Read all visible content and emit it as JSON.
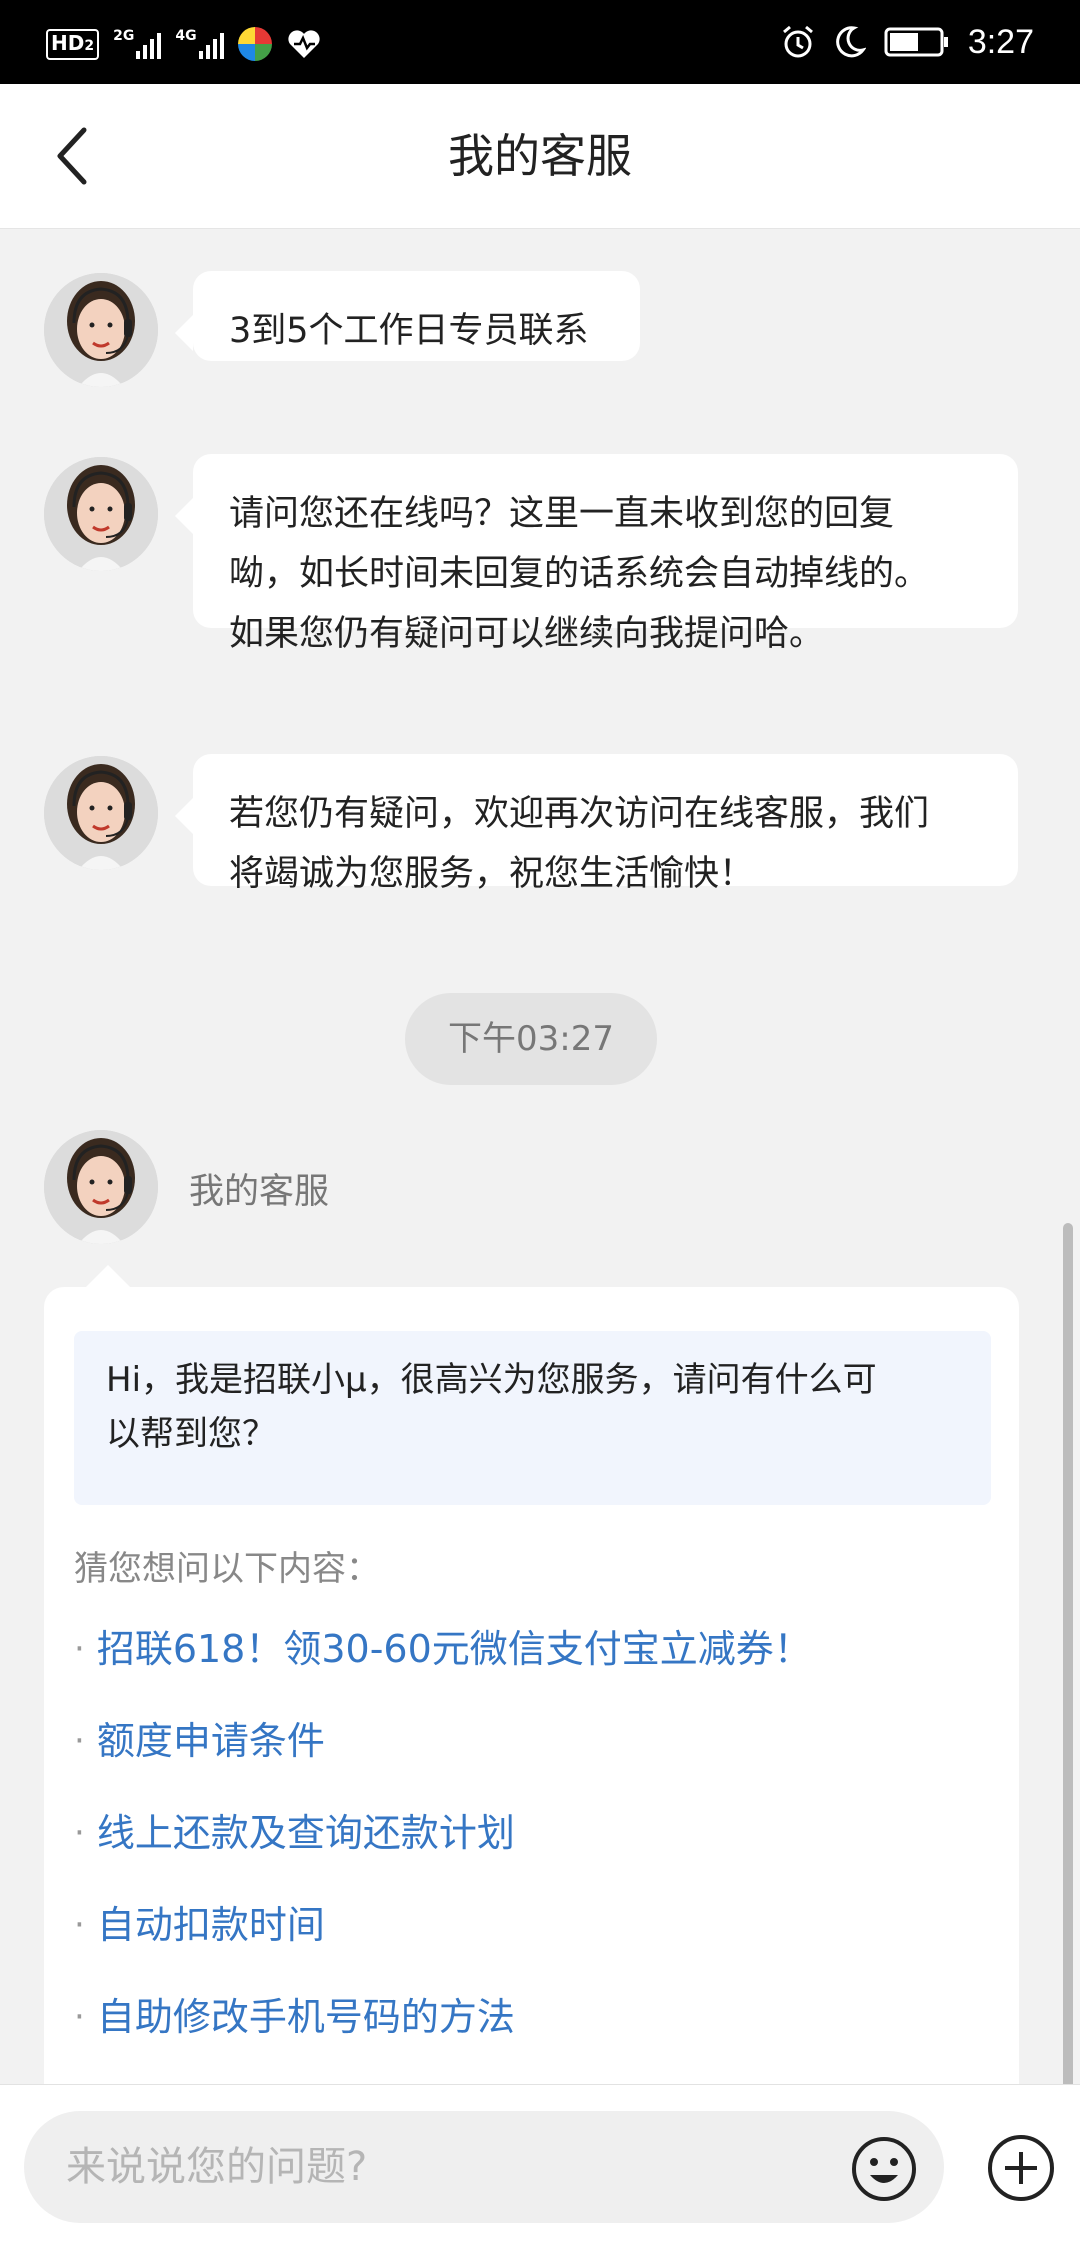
{
  "status_bar": {
    "hd_label": "HD",
    "sim1_label": "2",
    "net1_label": "2G",
    "net2_label": "4G",
    "time": "3:27",
    "icons": [
      "alarm-icon",
      "moon-icon",
      "battery-icon"
    ]
  },
  "header": {
    "title": "我的客服",
    "back_icon": "chevron-left-icon"
  },
  "messages": [
    {
      "lines": [
        "3到5个工作日专员联系"
      ]
    },
    {
      "lines": [
        "请问您还在线吗？这里一直未收到您的回复",
        "呦，如长时间未回复的话系统会自动掉线的。",
        "如果您仍有疑问可以继续向我提问哈。"
      ]
    },
    {
      "lines": [
        "若您仍有疑问，欢迎再次访问在线客服，我们",
        "将竭诚为您服务，祝您生活愉快！"
      ]
    }
  ],
  "timestamp": "下午03:27",
  "agent_name": "我的客服",
  "card": {
    "greeting_lines": [
      "Hi，我是招联小μ，很高兴为您服务，请问有什么可",
      "以帮到您？"
    ],
    "guess_label": "猜您想问以下内容：",
    "bullet": "·",
    "questions": [
      "招联618！领30-60元微信支付宝立减券！",
      "额度申请条件",
      "线上还款及查询还款计划",
      "自动扣款时间",
      "自助修改手机号码的方法"
    ]
  },
  "input": {
    "placeholder": "来说说您的问题?",
    "value": ""
  },
  "colors": {
    "link": "#3576c4",
    "background": "#f2f2f2",
    "greeting_bg": "#f1f5fd"
  }
}
